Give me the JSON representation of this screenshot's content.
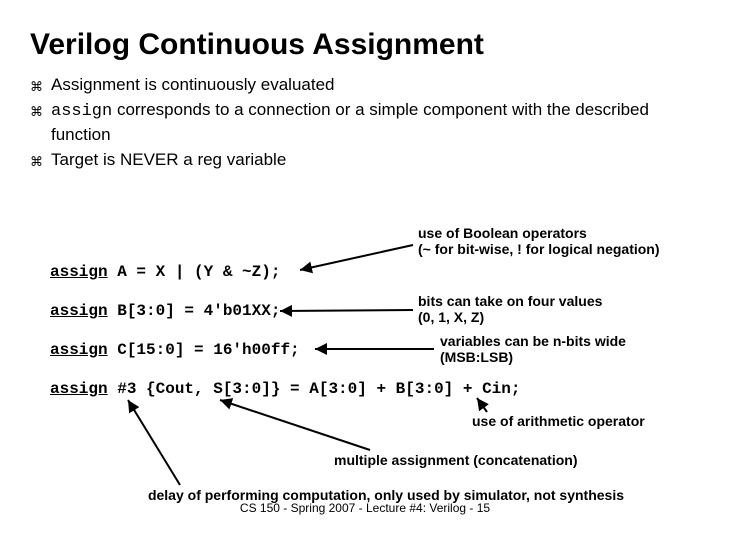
{
  "title": "Verilog Continuous Assignment",
  "bullets": {
    "b1": "Assignment is continuously evaluated",
    "b2a": "assign",
    "b2b": " corresponds to a connection or a simple component with the described function",
    "b3": "Target is NEVER a reg variable"
  },
  "code": {
    "l1a": "assign",
    "l1b": " A = X | (Y & ~Z);",
    "l2a": "assign",
    "l2b": " B[3:0] = 4'b01XX;",
    "l3a": "assign",
    "l3b": " C[15:0] = 16'h00ff;",
    "l4a": "assign",
    "l4b": " #3 {Cout, S[3:0]} = A[3:0] + B[3:0] + Cin;"
  },
  "ann": {
    "a1l1": "use of Boolean operators",
    "a1l2": "(~ for bit-wise, ! for logical negation)",
    "a2l1": "bits can take on four values",
    "a2l2": "(0, 1, X, Z)",
    "a3l1": "variables can be n-bits wide",
    "a3l2": "(MSB:LSB)",
    "a4": "use of arithmetic operator",
    "a5": "multiple assignment (concatenation)",
    "a6": "delay of performing computation, only used by simulator, not synthesis"
  },
  "footer": "CS 150 - Spring 2007 - Lecture #4: Verilog - 15"
}
